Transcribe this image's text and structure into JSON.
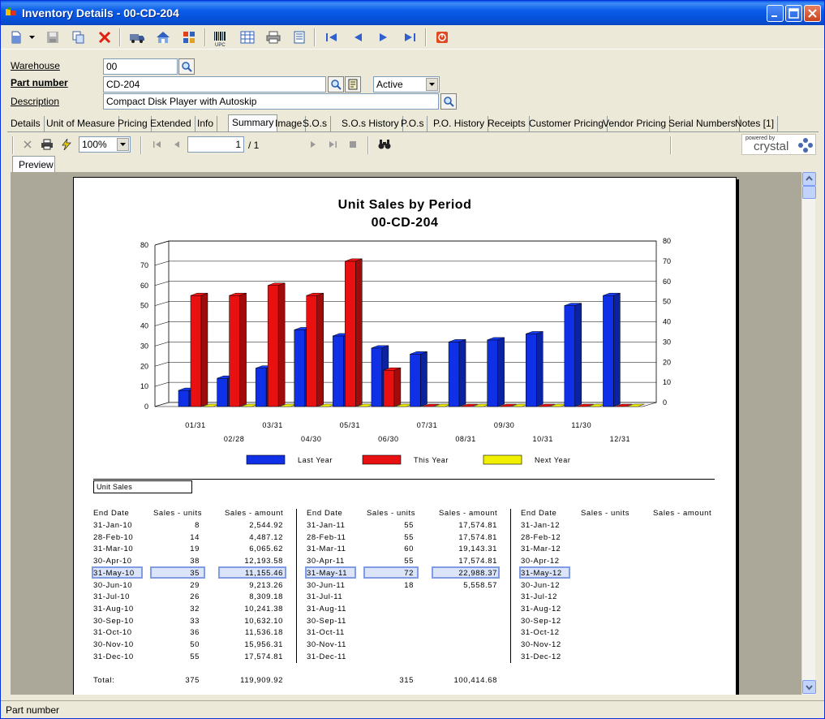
{
  "window": {
    "title": "Inventory Details - 00-CD-204"
  },
  "form": {
    "warehouse_label": "Warehouse",
    "warehouse_value": "00",
    "part_label": "Part number",
    "part_value": "CD-204",
    "status_value": "Active",
    "description_label": "Description",
    "description_value": "Compact Disk Player with Autoskip"
  },
  "tabs": [
    "Details",
    "Unit of Measure",
    "Pricing",
    "Extended",
    "Info",
    "Summary",
    "Image",
    "S.O.s",
    "S.O.s History",
    "P.O.s",
    "P.O. History",
    "Receipts",
    "Customer Pricing",
    "Vendor Pricing",
    "Serial Numbers",
    "Notes [1]"
  ],
  "active_tab": "Summary",
  "viewer": {
    "zoom": "100%",
    "page_current": "1",
    "page_total": "/ 1",
    "preview_tab": "Preview",
    "brand_small": "powered by",
    "brand": "crystal"
  },
  "report": {
    "title": "Unit Sales by Period",
    "subtitle": "00-CD-204",
    "section_label": "Unit Sales",
    "col_headers": [
      "End Date",
      "Sales - units",
      "Sales - amount"
    ],
    "year1": [
      [
        "31-Jan-10",
        "8",
        "2,544.92"
      ],
      [
        "28-Feb-10",
        "14",
        "4,487.12"
      ],
      [
        "31-Mar-10",
        "19",
        "6,065.62"
      ],
      [
        "30-Apr-10",
        "38",
        "12,193.58"
      ],
      [
        "31-May-10",
        "35",
        "11,155.46"
      ],
      [
        "30-Jun-10",
        "29",
        "9,213.26"
      ],
      [
        "31-Jul-10",
        "26",
        "8,309.18"
      ],
      [
        "31-Aug-10",
        "32",
        "10,241.38"
      ],
      [
        "30-Sep-10",
        "33",
        "10,632.10"
      ],
      [
        "31-Oct-10",
        "36",
        "11,536.18"
      ],
      [
        "30-Nov-10",
        "50",
        "15,956.31"
      ],
      [
        "31-Dec-10",
        "55",
        "17,574.81"
      ]
    ],
    "year2": [
      [
        "31-Jan-11",
        "55",
        "17,574.81"
      ],
      [
        "28-Feb-11",
        "55",
        "17,574.81"
      ],
      [
        "31-Mar-11",
        "60",
        "19,143.31"
      ],
      [
        "30-Apr-11",
        "55",
        "17,574.81"
      ],
      [
        "31-May-11",
        "72",
        "22,988.37"
      ],
      [
        "30-Jun-11",
        "18",
        "5,558.57"
      ],
      [
        "31-Jul-11",
        "",
        ""
      ],
      [
        "31-Aug-11",
        "",
        ""
      ],
      [
        "30-Sep-11",
        "",
        ""
      ],
      [
        "31-Oct-11",
        "",
        ""
      ],
      [
        "30-Nov-11",
        "",
        ""
      ],
      [
        "31-Dec-11",
        "",
        ""
      ]
    ],
    "year3": [
      [
        "31-Jan-12",
        "",
        ""
      ],
      [
        "28-Feb-12",
        "",
        ""
      ],
      [
        "31-Mar-12",
        "",
        ""
      ],
      [
        "30-Apr-12",
        "",
        ""
      ],
      [
        "31-May-12",
        "",
        ""
      ],
      [
        "30-Jun-12",
        "",
        ""
      ],
      [
        "31-Jul-12",
        "",
        ""
      ],
      [
        "31-Aug-12",
        "",
        ""
      ],
      [
        "30-Sep-12",
        "",
        ""
      ],
      [
        "31-Oct-12",
        "",
        ""
      ],
      [
        "30-Nov-12",
        "",
        ""
      ],
      [
        "31-Dec-12",
        "",
        ""
      ]
    ],
    "total_label": "Total:",
    "total1_units": "375",
    "total1_amount": "119,909.92",
    "total2_units": "315",
    "total2_amount": "100,414.68"
  },
  "chart_data": {
    "type": "bar",
    "categories": [
      "01/31",
      "02/28",
      "03/31",
      "04/30",
      "05/31",
      "06/30",
      "07/31",
      "08/31",
      "09/30",
      "10/31",
      "11/30",
      "12/31"
    ],
    "series": [
      {
        "name": "Last Year",
        "color": "#1030e8",
        "values": [
          8,
          14,
          19,
          38,
          35,
          29,
          26,
          32,
          33,
          36,
          50,
          55
        ]
      },
      {
        "name": "This Year",
        "color": "#e81010",
        "values": [
          55,
          55,
          60,
          55,
          72,
          18,
          0,
          0,
          0,
          0,
          0,
          0
        ]
      },
      {
        "name": "Next Year",
        "color": "#f0f000",
        "values": [
          0,
          0,
          0,
          0,
          0,
          0,
          0,
          0,
          0,
          0,
          0,
          0
        ]
      }
    ],
    "ylim": [
      0,
      80
    ],
    "yticks": [
      "0",
      "10",
      "20",
      "30",
      "40",
      "50",
      "60",
      "70",
      "80"
    ],
    "grid": true,
    "legend": "bottom"
  },
  "status": {
    "text": "Part number"
  }
}
